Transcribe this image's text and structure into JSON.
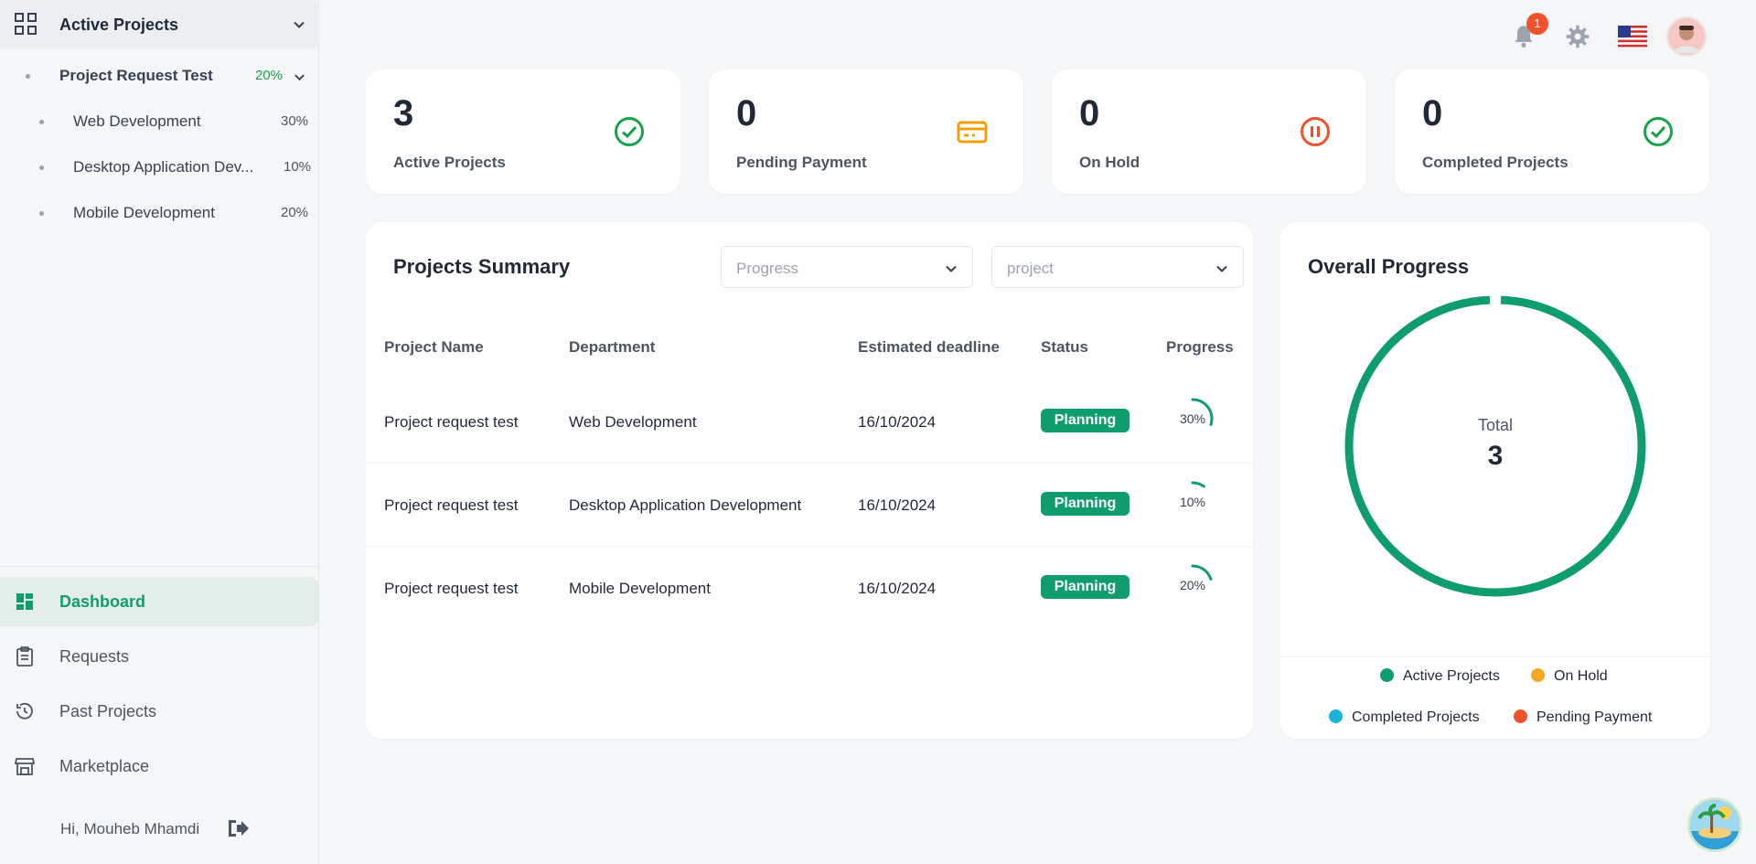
{
  "sidebar": {
    "header_title": "Active Projects",
    "tree": [
      {
        "label": "Project Request Test",
        "pct": "20%"
      },
      {
        "label": "Web Development",
        "pct": "30%"
      },
      {
        "label": "Desktop Application Dev...",
        "pct": "10%"
      },
      {
        "label": "Mobile Development",
        "pct": "20%"
      }
    ],
    "nav": [
      {
        "label": "Dashboard",
        "icon": "dashboard-icon"
      },
      {
        "label": "Requests",
        "icon": "clipboard-icon"
      },
      {
        "label": "Past Projects",
        "icon": "history-icon"
      },
      {
        "label": "Marketplace",
        "icon": "store-icon"
      }
    ],
    "user_greeting": "Hi, Mouheb Mhamdi"
  },
  "topbar": {
    "notification_count": "1"
  },
  "stats": [
    {
      "value": "3",
      "label": "Active Projects",
      "icon": "check-circle-icon",
      "color": "#16a34a"
    },
    {
      "value": "0",
      "label": "Pending Payment",
      "icon": "credit-card-icon",
      "color": "#f59e0b"
    },
    {
      "value": "0",
      "label": "On Hold",
      "icon": "pause-circle-icon",
      "color": "#f0532b"
    },
    {
      "value": "0",
      "label": "Completed Projects",
      "icon": "check-circle-icon",
      "color": "#16a34a"
    }
  ],
  "summary": {
    "title": "Projects Summary",
    "filter_progress_placeholder": "Progress",
    "filter_project_placeholder": "project",
    "columns": [
      "Project Name",
      "Department",
      "Estimated deadline",
      "Status",
      "Progress"
    ],
    "rows": [
      {
        "name": "Project request test",
        "department": "Web Development",
        "deadline": "16/10/2024",
        "status": "Planning",
        "progress": 30,
        "progress_label": "30%"
      },
      {
        "name": "Project request test",
        "department": "Desktop Application Development",
        "deadline": "16/10/2024",
        "status": "Planning",
        "progress": 10,
        "progress_label": "10%"
      },
      {
        "name": "Project request test",
        "department": "Mobile Development",
        "deadline": "16/10/2024",
        "status": "Planning",
        "progress": 20,
        "progress_label": "20%"
      }
    ]
  },
  "overall": {
    "title": "Overall Progress",
    "total_label": "Total",
    "total_value": "3",
    "legend": [
      {
        "label": "Active Projects",
        "color": "#0f9d6b"
      },
      {
        "label": "On Hold",
        "color": "#f5a623"
      },
      {
        "label": "Completed Projects",
        "color": "#1ab3d9"
      },
      {
        "label": "Pending Payment",
        "color": "#f0532b"
      }
    ],
    "slices": [
      {
        "name": "Active Projects",
        "value": 3
      },
      {
        "name": "On Hold",
        "value": 0
      },
      {
        "name": "Completed Projects",
        "value": 0
      },
      {
        "name": "Pending Payment",
        "value": 0
      }
    ]
  },
  "colors": {
    "accent": "#0f9d6b",
    "badge": "#f0532b"
  }
}
